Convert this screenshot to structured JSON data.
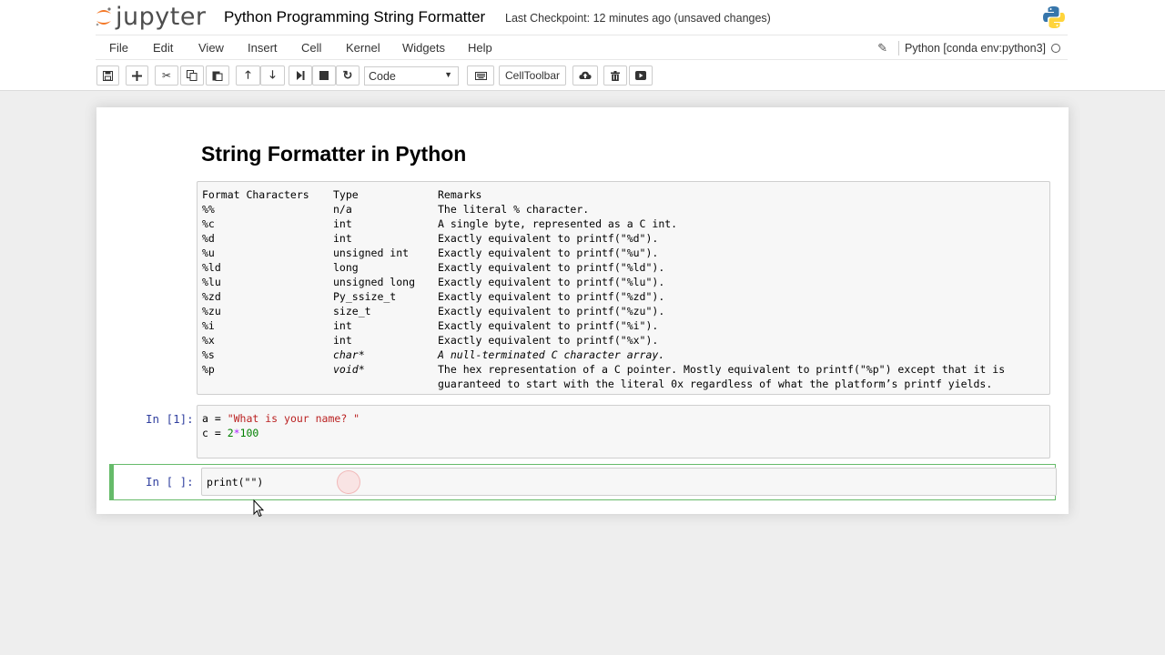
{
  "header": {
    "logo_text": "jupyter",
    "notebook_name": "Python Programming String Formatter",
    "checkpoint": "Last Checkpoint: 12 minutes ago (unsaved changes)"
  },
  "menu": {
    "items": [
      "File",
      "Edit",
      "View",
      "Insert",
      "Cell",
      "Kernel",
      "Widgets",
      "Help"
    ],
    "kernel_name": "Python [conda env:python3]"
  },
  "toolbar": {
    "cell_type": "Code",
    "celltoolbar_label": "CellToolbar"
  },
  "notebook": {
    "markdown_title": "String Formatter in Python",
    "table": {
      "headers": [
        "Format Characters",
        "Type",
        "Remarks"
      ],
      "rows": [
        [
          "%%",
          "n/a",
          "The literal % character."
        ],
        [
          "%c",
          "int",
          "A single byte, represented as a C int."
        ],
        [
          "%d",
          "int",
          "Exactly equivalent to printf(\"%d\")."
        ],
        [
          "%u",
          "unsigned int",
          "Exactly equivalent to printf(\"%u\")."
        ],
        [
          "%ld",
          "long",
          "Exactly equivalent to printf(\"%ld\")."
        ],
        [
          "%lu",
          "unsigned long",
          "Exactly equivalent to printf(\"%lu\")."
        ],
        [
          "%zd",
          "Py_ssize_t",
          "Exactly equivalent to printf(\"%zd\")."
        ],
        [
          "%zu",
          "size_t",
          "Exactly equivalent to printf(\"%zu\")."
        ],
        [
          "%i",
          "int",
          "Exactly equivalent to printf(\"%i\")."
        ],
        [
          "%x",
          "int",
          "Exactly equivalent to printf(\"%x\")."
        ],
        [
          "%s",
          "char*",
          "A null-terminated C character array."
        ],
        [
          "%p",
          "void*",
          "The hex representation of a C pointer. Mostly equivalent to printf(\"%p\") except that it is"
        ]
      ],
      "continuation": "guaranteed to start with the literal 0x regardless of what the platform’s printf yields."
    },
    "cell1": {
      "prompt": "In [1]:",
      "line1_var": "a = ",
      "line1_str": "\"What is your name? \"",
      "line2_var": "c = ",
      "line2_num1": "2",
      "line2_op": "*",
      "line2_num2": "100"
    },
    "cell2": {
      "prompt": "In [ ]:",
      "code": "print(\"\")"
    }
  },
  "colors": {
    "prompt": "#303f9f",
    "active_cell_border": "#66bb6a",
    "string": "#ba2121",
    "number": "#008000"
  }
}
